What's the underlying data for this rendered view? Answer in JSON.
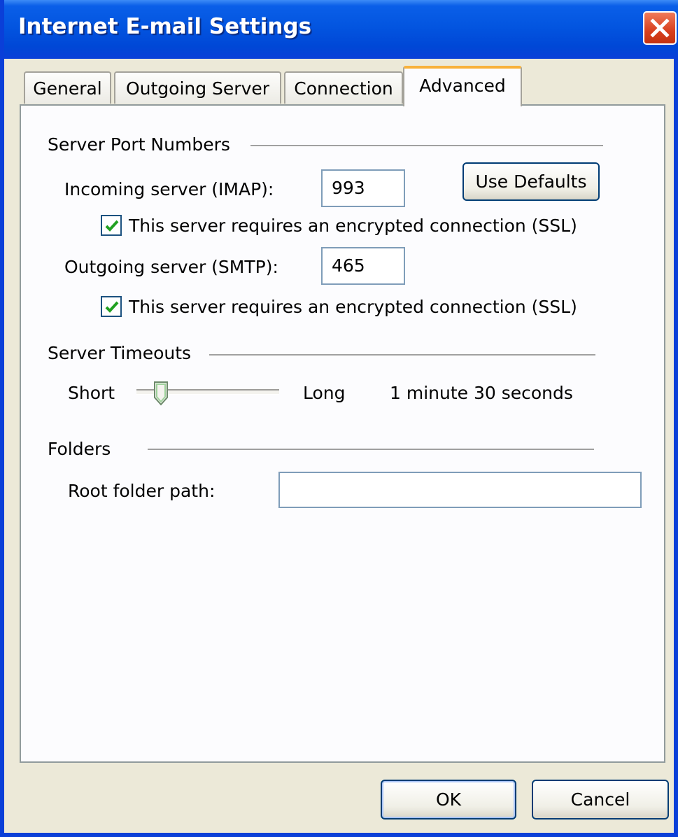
{
  "window": {
    "title": "Internet E-mail Settings"
  },
  "tabs": [
    {
      "label": "General",
      "active": false
    },
    {
      "label": "Outgoing Server",
      "active": false
    },
    {
      "label": "Connection",
      "active": false
    },
    {
      "label": "Advanced",
      "active": true
    }
  ],
  "ports": {
    "heading": "Server Port Numbers",
    "incoming_label": "Incoming server (IMAP):",
    "incoming_value": "993",
    "incoming_ssl_label": "This server requires an encrypted connection (SSL)",
    "incoming_ssl_checked": true,
    "outgoing_label": "Outgoing server (SMTP):",
    "outgoing_value": "465",
    "outgoing_ssl_label": "This server requires an encrypted connection (SSL)",
    "outgoing_ssl_checked": true,
    "defaults_button": "Use Defaults"
  },
  "timeouts": {
    "heading": "Server Timeouts",
    "short_label": "Short",
    "long_label": "Long",
    "value_text": "1 minute 30 seconds",
    "slider_fraction": 0.17
  },
  "folders": {
    "heading": "Folders",
    "root_label": "Root folder path:",
    "root_value": ""
  },
  "footer": {
    "ok_button": "OK",
    "cancel_button": "Cancel"
  },
  "colors": {
    "titlebar": "#0355e0",
    "close_button": "#d8401e",
    "checkmark": "#21a121",
    "tab_highlight": "#f8b13a"
  }
}
